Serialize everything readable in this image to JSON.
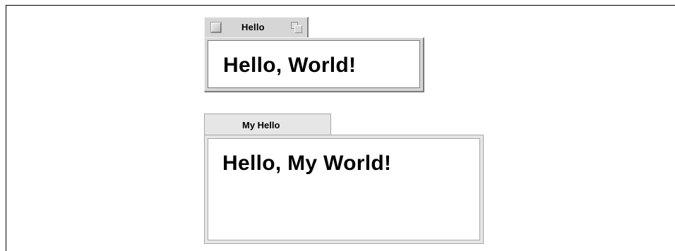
{
  "window_hello": {
    "title": "Hello",
    "content_text": "Hello, World!",
    "close_icon": "close-box-icon",
    "zoom_icon": "zoom-box-icon"
  },
  "window_my_hello": {
    "title": "My Hello",
    "content_text": "Hello, My World!"
  },
  "colors": {
    "background": "#ffffff",
    "frame_gray": "#d6d6d6",
    "frame_light_gray": "#e6e6e6",
    "text": "#000000"
  }
}
